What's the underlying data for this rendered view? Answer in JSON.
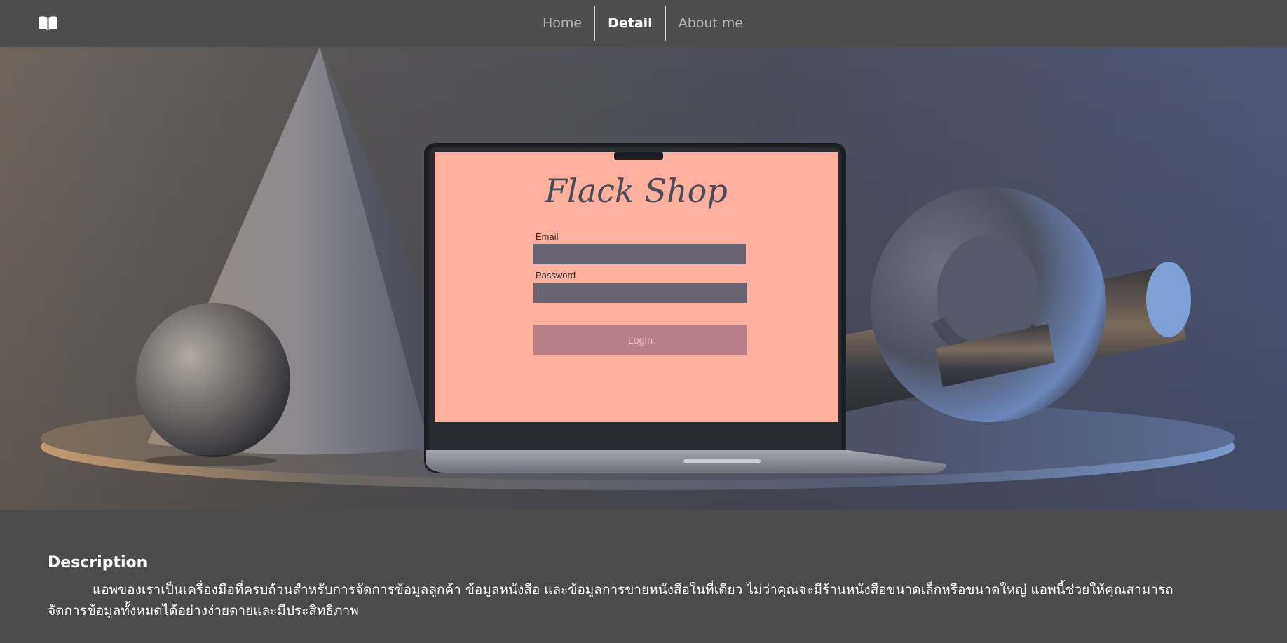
{
  "nav": {
    "brand_icon": "open-book-icon",
    "links": [
      {
        "label": "Home",
        "active": false
      },
      {
        "label": "Detail",
        "active": true
      },
      {
        "label": "About me",
        "active": false
      }
    ]
  },
  "hero": {
    "screen": {
      "logo": "Flack Shop",
      "email_label": "Email",
      "password_label": "Password",
      "login_label": "LogIn"
    }
  },
  "description": {
    "title": "Description",
    "paragraph": "แอพของเราเป็นเครื่องมือที่ครบถ้วนสำหรับการจัดการข้อมูลลูกค้า ข้อมูลหนังสือ และข้อมูลการขายหนังสือในที่เดียว ไม่ว่าคุณจะมีร้านหนังสือขนาดเล็กหรือขนาดใหญ่ แอพนี้ช่วยให้คุณสามารถจัดการข้อมูลทั้งหมดได้อย่างง่ายดายและมีประสิทธิภาพ"
  },
  "colors": {
    "nav_bg": "#4d4d4d",
    "page_bg": "#4b4b4b",
    "screen_pink": "#ffb09e",
    "field_gray": "#6a6472",
    "login_button": "#b88088"
  }
}
